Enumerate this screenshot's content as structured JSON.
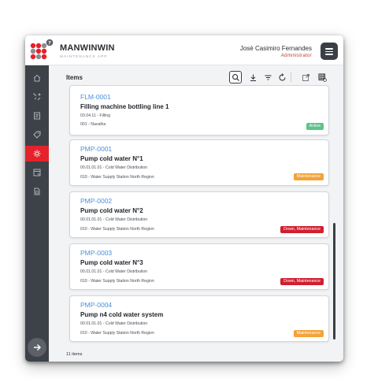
{
  "header": {
    "brand_name": "MANWINWIN",
    "brand_tagline": "MAINTENANCE APP",
    "user_name": "José Casimiro Fernandes",
    "user_role": "Administrator"
  },
  "sidebar": {
    "items": [
      {
        "icon": "home-icon",
        "active": false
      },
      {
        "icon": "tools-icon",
        "active": false
      },
      {
        "icon": "document-icon",
        "active": false
      },
      {
        "icon": "tag-icon",
        "active": false
      },
      {
        "icon": "gear-settings-icon",
        "active": true
      },
      {
        "icon": "report-icon",
        "active": false
      },
      {
        "icon": "export-icon",
        "active": false
      }
    ]
  },
  "toolbar": {
    "title": "Items",
    "actions": [
      "search-icon",
      "download-icon",
      "filter-icon",
      "refresh-icon",
      "open-external-icon",
      "grid-settings-icon"
    ]
  },
  "items": [
    {
      "code": "FLM-0001",
      "name": "Filling machine bottling line 1",
      "line1": "03.04.11 - Filling",
      "line2": "001 - Navalha",
      "badge": "Active",
      "badge_color": "#5cc48a"
    },
    {
      "code": "PMP-0001",
      "name": "Pump cold water N°1",
      "line1": "00.01.01.01 - Cold Water Distribution",
      "line2": "010 - Water Supply Station North Region",
      "badge": "Maintenance",
      "badge_color": "#f2a33a"
    },
    {
      "code": "PMP-0002",
      "name": "Pump cold water N°2",
      "line1": "00.01.01.01 - Cold Water Distribution",
      "line2": "010 - Water Supply Station North Region",
      "badge": "Down, Maintenance",
      "badge_color": "#d11f2e"
    },
    {
      "code": "PMP-0003",
      "name": "Pump cold water N°3",
      "line1": "00.01.01.01 - Cold Water Distribution",
      "line2": "010 - Water Supply Station North Region",
      "badge": "Down, Maintenance",
      "badge_color": "#d11f2e"
    },
    {
      "code": "PMP-0004",
      "name": "Pump n4 cold water system",
      "line1": "00.01.01.01 - Cold Water Distribution",
      "line2": "010 - Water Supply Station North Region",
      "badge": "Maintenance",
      "badge_color": "#f2a33a"
    }
  ],
  "footer": {
    "count_label": "11 items"
  },
  "colors": {
    "accent": "#e4222b",
    "sidebar": "#3d4248",
    "link": "#4a90d9"
  }
}
